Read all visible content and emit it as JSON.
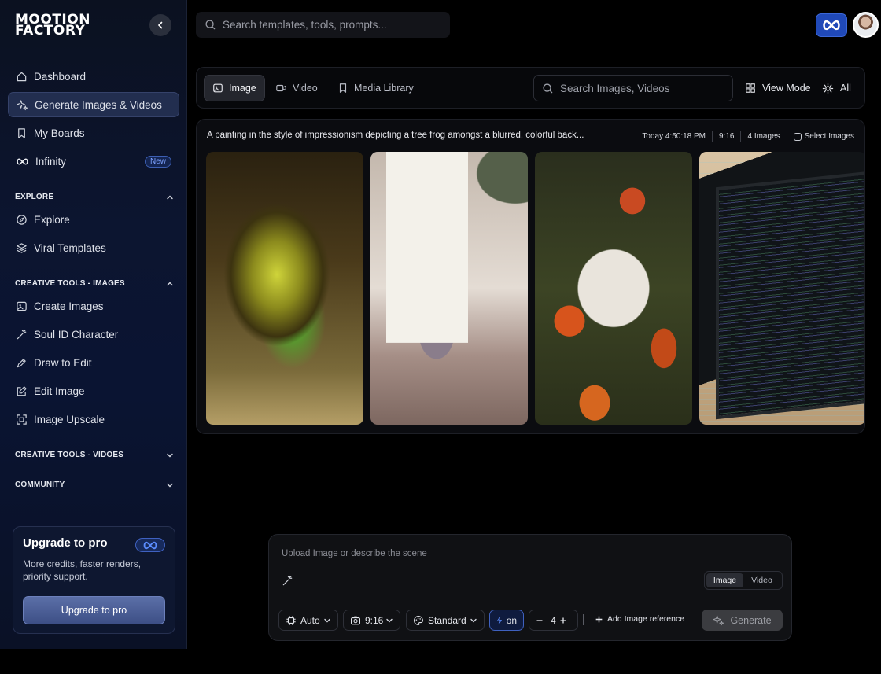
{
  "brand": {
    "logo_text": "MOOTION\nFACTORY"
  },
  "top": {
    "search_placeholder": "Search templates, tools, prompts..."
  },
  "sidebar": {
    "nav": [
      {
        "label": "Dashboard",
        "icon": "home-icon"
      },
      {
        "label": "Generate Images & Videos",
        "icon": "sparkles-icon",
        "active": true
      },
      {
        "label": "My Boards",
        "icon": "bookmark-icon"
      },
      {
        "label": "Infinity",
        "icon": "infinity-icon",
        "badge": "New"
      }
    ],
    "sections": {
      "explore": {
        "title": "EXPLORE",
        "expanded": true,
        "items": [
          {
            "label": "Explore",
            "icon": "compass-icon"
          },
          {
            "label": "Viral Templates",
            "icon": "layers-icon"
          }
        ]
      },
      "images": {
        "title": "CREATIVE TOOLS - IMAGES",
        "expanded": true,
        "items": [
          {
            "label": "Create Images",
            "icon": "image-icon"
          },
          {
            "label": "Soul ID Character",
            "icon": "magic-wand-icon"
          },
          {
            "label": "Draw to Edit",
            "icon": "pen-icon"
          },
          {
            "label": "Edit Image",
            "icon": "edit-icon"
          },
          {
            "label": "Image Upscale",
            "icon": "upscale-icon"
          }
        ]
      },
      "videos": {
        "title": "CREATIVE TOOLS - VIDOES",
        "expanded": false
      },
      "community": {
        "title": "COMMUNITY",
        "expanded": false
      }
    },
    "upgrade": {
      "title": "Upgrade to pro",
      "text": "More credits, faster renders, priority support.",
      "button": "Upgrade to pro"
    }
  },
  "filters": {
    "tabs": [
      {
        "label": "Image",
        "active": true
      },
      {
        "label": "Video"
      },
      {
        "label": "Media Library"
      }
    ],
    "search_placeholder": "Search Images, Videos",
    "view_mode": "View Mode",
    "all": "All"
  },
  "generation": {
    "prompt": "A painting in the style of impressionism depicting a tree frog amongst a blurred, colorful back...",
    "time": "Today 4:50:18 PM",
    "ratio": "9:16",
    "count": "4 Images",
    "select": "Select Images",
    "images": [
      "abstract-sculpture",
      "woman-at-window",
      "cup-with-leaves",
      "laptop-code"
    ]
  },
  "composer": {
    "placeholder": "Upload Image or describe the scene",
    "modes": [
      "Image",
      "Video"
    ],
    "active_mode": "Image",
    "auto": "Auto",
    "ratio": "9:16",
    "quality": "Standard",
    "boost": "on",
    "quantity": "4",
    "add_reference": "Add Image reference",
    "generate": "Generate"
  },
  "colors": {
    "accent": "#2049b8",
    "active_nav": "#222e4f",
    "background": "#000000"
  }
}
